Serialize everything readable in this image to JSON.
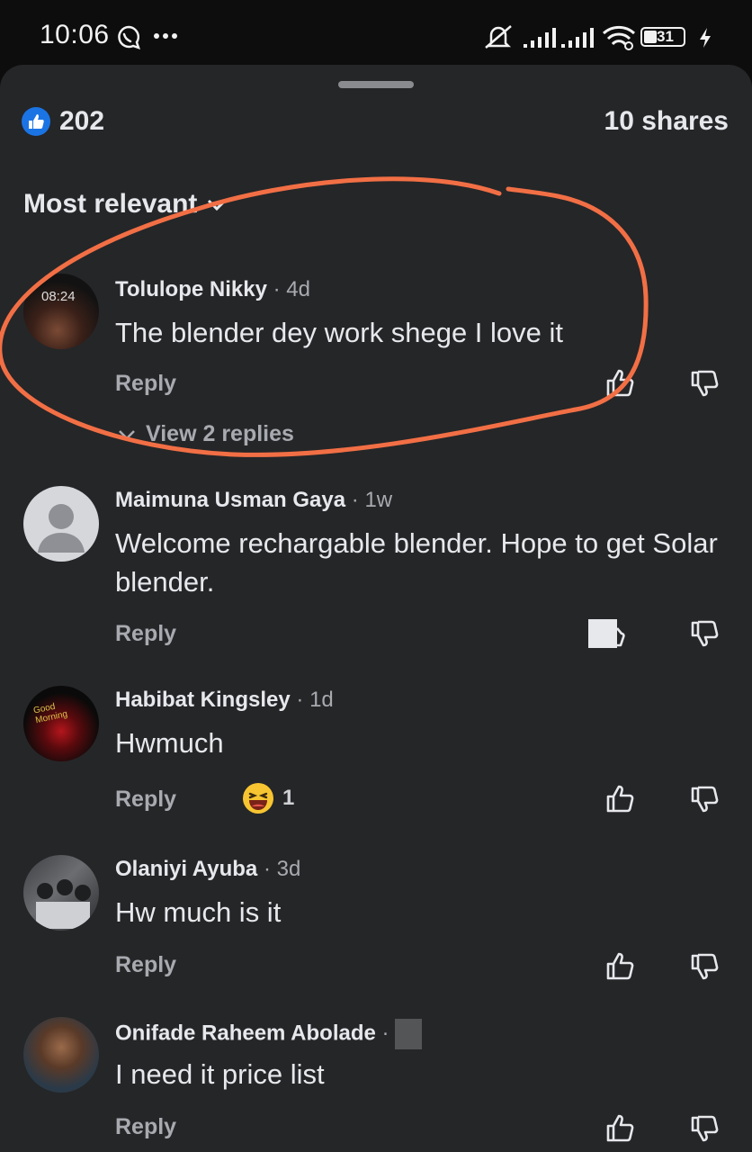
{
  "status_bar": {
    "time": "10:06",
    "battery": "31"
  },
  "post_stats": {
    "likes": "202",
    "shares": "10 shares"
  },
  "sort": {
    "label": "Most relevant"
  },
  "comments": [
    {
      "name": "Tolulope Nikky",
      "age": "4d",
      "text": "The blender dey work shege I love it",
      "reply": "Reply",
      "view_replies": "View 2 replies",
      "avatar_overlay": "08:24"
    },
    {
      "name": "Maimuna Usman Gaya",
      "age": "1w",
      "text": "Welcome rechargable blender. Hope to get Solar blender.",
      "reply": "Reply"
    },
    {
      "name": "Habibat Kingsley",
      "age": "1d",
      "text": "Hwmuch",
      "reply": "Reply",
      "reaction_count": "1",
      "avatar_overlay": "Good Morning"
    },
    {
      "name": "Olaniyi Ayuba",
      "age": "3d",
      "text": "Hw much is it",
      "reply": "Reply"
    },
    {
      "name": "Onifade Raheem Abolade",
      "age": "",
      "text": "I need it  price list",
      "reply": "Reply"
    }
  ],
  "colors": {
    "sheet_bg": "#252628",
    "accent_blue": "#1b74e4",
    "annotation": "#f26f45"
  }
}
